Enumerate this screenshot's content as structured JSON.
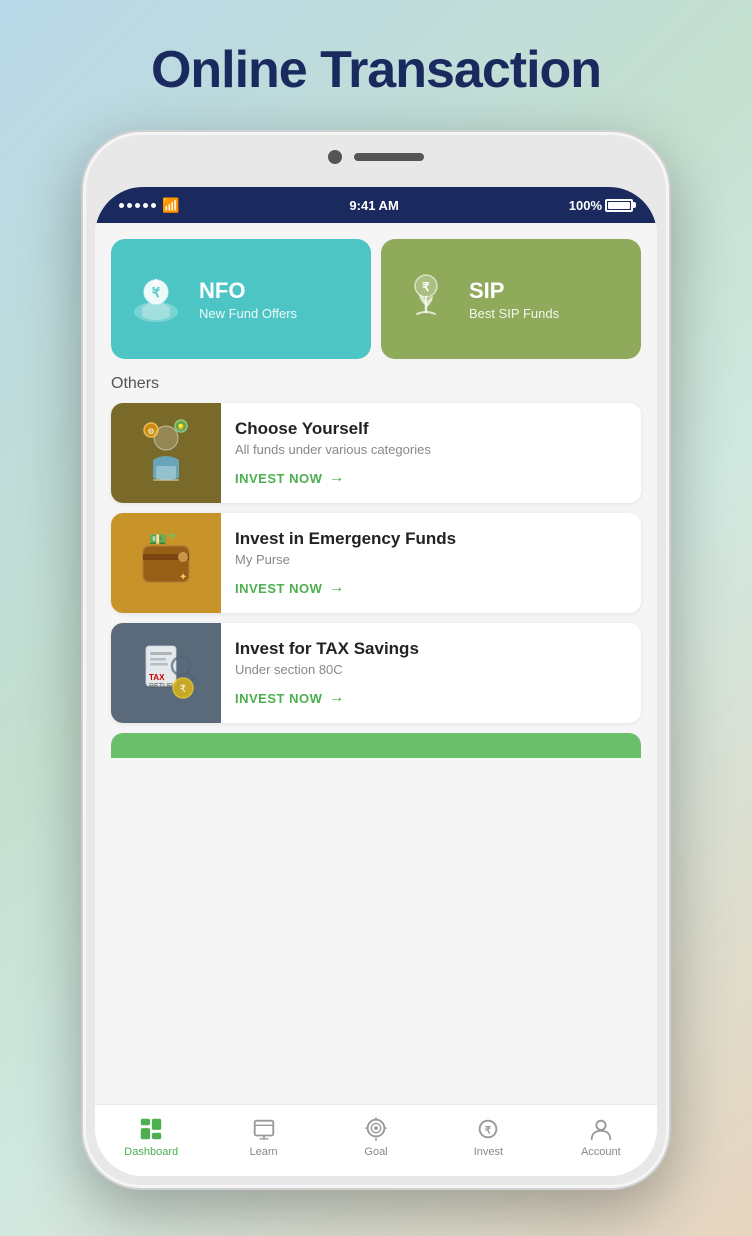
{
  "page": {
    "title": "Online Transaction",
    "background": "#b8d8e8"
  },
  "status_bar": {
    "time": "9:41 AM",
    "battery": "100%",
    "signal_dots": 5
  },
  "cards": [
    {
      "id": "nfo",
      "title": "NFO",
      "subtitle": "New Fund Offers",
      "bg_color": "#4ec5c5",
      "icon": "💰"
    },
    {
      "id": "sip",
      "title": "SIP",
      "subtitle": "Best SIP Funds",
      "bg_color": "#8faa5a",
      "icon": "🌱"
    }
  ],
  "others_label": "Others",
  "list_items": [
    {
      "id": "choose-yourself",
      "title": "Choose Yourself",
      "subtitle": "All funds under various categories",
      "invest_label": "INVEST NOW",
      "bg_color": "#7a6a2a",
      "icon": "🧑‍💼"
    },
    {
      "id": "emergency-funds",
      "title": "Invest in Emergency Funds",
      "subtitle": "My Purse",
      "invest_label": "INVEST NOW",
      "bg_color": "#c8942a",
      "icon": "👜"
    },
    {
      "id": "tax-savings",
      "title": "Invest for TAX Savings",
      "subtitle": "Under section 80C",
      "invest_label": "INVEST NOW",
      "bg_color": "#5a6a7a",
      "icon": "📋"
    }
  ],
  "bottom_nav": [
    {
      "id": "dashboard",
      "label": "Dashboard",
      "active": true
    },
    {
      "id": "learn",
      "label": "Learn",
      "active": false
    },
    {
      "id": "goal",
      "label": "Goal",
      "active": false
    },
    {
      "id": "invest",
      "label": "Invest",
      "active": false
    },
    {
      "id": "account",
      "label": "Account",
      "active": false
    }
  ]
}
